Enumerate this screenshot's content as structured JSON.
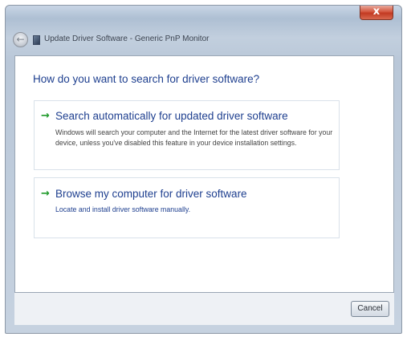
{
  "window": {
    "title": "Update Driver Software - Generic PnP Monitor",
    "close_label": "x",
    "back_label": "←"
  },
  "main": {
    "question": "How do you want to search for driver software?",
    "options": [
      {
        "icon": "green-arrow-icon",
        "arrow": "→",
        "title": "Search automatically for updated driver software",
        "description": "Windows will search your computer and the Internet for the latest driver software for your device, unless you've disabled this feature in your device installation settings."
      },
      {
        "icon": "green-arrow-icon",
        "arrow": "→",
        "title": "Browse my computer for driver software",
        "description": "Locate and install driver software manually."
      }
    ]
  },
  "footer": {
    "cancel_label": "Cancel"
  },
  "colors": {
    "link_blue": "#1e3f8f",
    "arrow_green": "#1f9a2a",
    "close_red": "#c23a22"
  }
}
